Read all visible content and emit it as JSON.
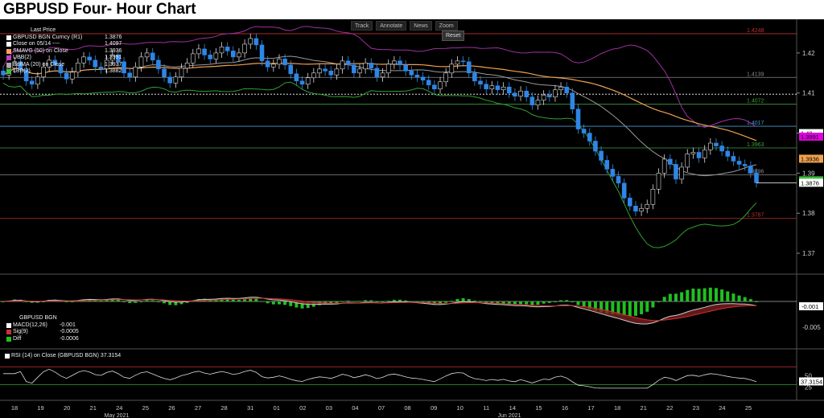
{
  "title": "GBPUSD Four- Hour Chart",
  "toolbar": {
    "track": "Track",
    "annotate": "Annotate",
    "news": "News",
    "zoom": "Zoom",
    "reset": "Reset"
  },
  "legend_main": {
    "header": "Last Price",
    "items": [
      {
        "label": "GBPUSD BGN Curncy (R1)",
        "value": "1.3876",
        "color": "#ffffff"
      },
      {
        "label": "Close on 05/14 ----",
        "value": "1.4097",
        "color": "#ffffff"
      },
      {
        "label": "SMAVG (50) on Close",
        "value": "1.3936",
        "color": "#f4a460"
      },
      {
        "label": "UBB(2)",
        "value": "1.3991",
        "color": "#c040c0"
      },
      {
        "label": "BolMA (20) on Close",
        "value": "1.3937",
        "color": "#aaaaaa"
      },
      {
        "label": "LBB(2)",
        "value": "1.3882",
        "color": "#40c040"
      }
    ]
  },
  "legend_macd": {
    "header": "GBPUSD BGN",
    "items": [
      {
        "label": "MACD(12,26)",
        "value": "-0.001",
        "color": "#ffffff"
      },
      {
        "label": "Sig(9)",
        "value": "-0.0005",
        "color": "#d03030"
      },
      {
        "label": "Diff",
        "value": "-0.0006",
        "color": "#20c020"
      }
    ]
  },
  "legend_rsi": {
    "label": "RSI (14)  on Close (GBPUSD BGN) 37.3154",
    "color": "#ffffff"
  },
  "chart_data": {
    "type": "candlestick",
    "y_ticks": [
      "1.42",
      "1.41",
      "1.40",
      "1.39",
      "1.38",
      "1.37"
    ],
    "ylim": [
      1.365,
      1.428
    ],
    "x_labels": [
      "18",
      "19",
      "20",
      "21",
      "24",
      "25",
      "26",
      "27",
      "28",
      "31",
      "01",
      "02",
      "03",
      "04",
      "07",
      "08",
      "09",
      "10",
      "11",
      "14",
      "15",
      "16",
      "17",
      "18",
      "21",
      "22",
      "23",
      "24",
      "25"
    ],
    "month_labels": [
      "May 2021",
      "Jun 2021"
    ],
    "h_levels": [
      {
        "value": 1.4248,
        "label": "1.4248",
        "color": "#c03030"
      },
      {
        "value": 1.4139,
        "label": "1.4139",
        "color": "#888888"
      },
      {
        "value": 1.4097,
        "label": "",
        "color": "#ffffff"
      },
      {
        "value": 1.4072,
        "label": "1.4072",
        "color": "#40a040"
      },
      {
        "value": 1.4017,
        "label": "1.4017",
        "color": "#4a9ad0"
      },
      {
        "value": 1.3963,
        "label": "1.3963",
        "color": "#40a040"
      },
      {
        "value": 1.3896,
        "label": "1.3896",
        "color": "#888888"
      },
      {
        "value": 1.3787,
        "label": "1.3787",
        "color": "#c03030"
      }
    ],
    "axis_tags": [
      {
        "value": 1.4,
        "label": "1.40",
        "color": "#ffffff",
        "text": "#000"
      },
      {
        "value": 1.3991,
        "label": "1.3991",
        "color": "#e000e0",
        "text": "#000"
      },
      {
        "value": 1.3936,
        "label": "1.3936",
        "color": "#f0a050",
        "text": "#000"
      },
      {
        "value": 1.3882,
        "label": "",
        "color": "#40c040",
        "text": "#000"
      },
      {
        "value": 1.3876,
        "label": "1.3876",
        "color": "#ffffff",
        "text": "#000"
      }
    ],
    "close": [
      1.4145,
      1.4162,
      1.4178,
      1.4158,
      1.413,
      1.4122,
      1.414,
      1.4165,
      1.4182,
      1.417,
      1.415,
      1.4135,
      1.4152,
      1.4175,
      1.419,
      1.4182,
      1.4165,
      1.416,
      1.4182,
      1.4195,
      1.4178,
      1.415,
      1.414,
      1.4165,
      1.419,
      1.42,
      1.4182,
      1.416,
      1.414,
      1.4125,
      1.414,
      1.4162,
      1.4175,
      1.4198,
      1.421,
      1.4195,
      1.4185,
      1.42,
      1.4215,
      1.4205,
      1.419,
      1.42,
      1.4222,
      1.4236,
      1.422,
      1.418,
      1.4165,
      1.4172,
      1.4185,
      1.417,
      1.4148,
      1.413,
      1.4122,
      1.4138,
      1.415,
      1.416,
      1.4155,
      1.4145,
      1.416,
      1.418,
      1.417,
      1.415,
      1.416,
      1.4175,
      1.4162,
      1.414,
      1.415,
      1.4172,
      1.418,
      1.417,
      1.4155,
      1.4145,
      1.414,
      1.4132,
      1.412,
      1.411,
      1.4128,
      1.415,
      1.4172,
      1.418,
      1.4178,
      1.415,
      1.413,
      1.4122,
      1.411,
      1.4118,
      1.4108,
      1.4115,
      1.41,
      1.4092,
      1.4105,
      1.409,
      1.407,
      1.4082,
      1.4095,
      1.409,
      1.4108,
      1.4115,
      1.41,
      1.406,
      1.401,
      1.4,
      1.398,
      1.3955,
      1.3932,
      1.391,
      1.3892,
      1.3875,
      1.3838,
      1.3818,
      1.3805,
      1.3812,
      1.3822,
      1.386,
      1.39,
      1.3935,
      1.3922,
      1.3885,
      1.3915,
      1.3948,
      1.3952,
      1.3938,
      1.3958,
      1.3975,
      1.3968,
      1.3955,
      1.3942,
      1.393,
      1.3922,
      1.3918,
      1.39,
      1.3876
    ],
    "close_0514": 1.4097,
    "macd_ticks": [
      "-0.005"
    ],
    "macd_tags": [
      {
        "label": "-0.001",
        "color": "#ffffff",
        "text": "#000"
      }
    ],
    "rsi_ticks": [
      "50",
      "25"
    ],
    "rsi_tags": [
      {
        "label": "37.3154",
        "color": "#ffffff",
        "text": "#000"
      }
    ]
  }
}
